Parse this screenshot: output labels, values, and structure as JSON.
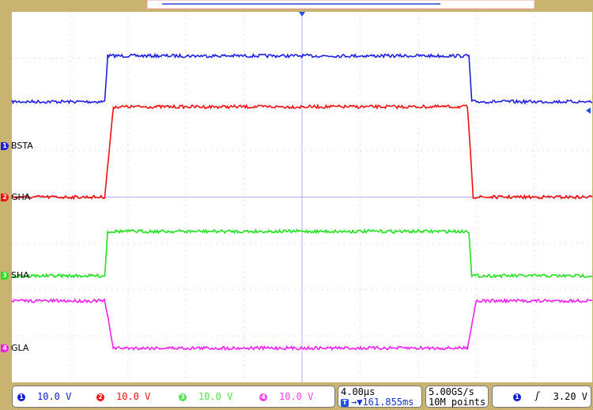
{
  "chart_data": {
    "type": "line",
    "x_unit": "µs",
    "x_per_div": 4,
    "x_range": [
      -20,
      20
    ],
    "y_per_div_V": 10,
    "grid": true,
    "series": [
      {
        "name": "BSTA",
        "channel": "1",
        "color": "#2020e0",
        "ground_div": -1.1,
        "points": [
          [
            -20,
            9.6
          ],
          [
            -13.6,
            9.6
          ],
          [
            -13.4,
            19.5
          ],
          [
            11.5,
            19.5
          ],
          [
            11.7,
            9.6
          ],
          [
            20,
            9.6
          ]
        ]
      },
      {
        "name": "GHA",
        "channel": "2",
        "color": "#f01010",
        "ground_div": 0,
        "points": [
          [
            -20,
            0
          ],
          [
            -13.6,
            0
          ],
          [
            -13.0,
            19.5
          ],
          [
            11.4,
            19.5
          ],
          [
            11.8,
            0
          ],
          [
            20,
            0
          ]
        ]
      },
      {
        "name": "SHA",
        "channel": "3",
        "color": "#20e020",
        "ground_div": 1.7,
        "points": [
          [
            -20,
            0
          ],
          [
            -13.6,
            0
          ],
          [
            -13.4,
            9.6
          ],
          [
            11.5,
            9.6
          ],
          [
            11.7,
            0
          ],
          [
            20,
            0
          ]
        ]
      },
      {
        "name": "GLA",
        "channel": "4",
        "color": "#f020f0",
        "ground_div": 3.26,
        "points": [
          [
            -20,
            10.2
          ],
          [
            -13.6,
            10.2
          ],
          [
            -13.0,
            0
          ],
          [
            11.4,
            0
          ],
          [
            12.0,
            10.2
          ],
          [
            20,
            10.2
          ]
        ]
      }
    ]
  },
  "status": {
    "channels": [
      {
        "num": "1",
        "scale": "10.0 V",
        "color": "#1020d0"
      },
      {
        "num": "2",
        "scale": "10.0 V",
        "color": "#f01010"
      },
      {
        "num": "3",
        "scale": "10.0 V",
        "color": "#50e050"
      },
      {
        "num": "4",
        "scale": "10.0 V",
        "color": "#f040f0"
      }
    ],
    "timebase": "4.00µs",
    "trigger_position": "▼161.855ms",
    "trigger_icon": "T",
    "sample_rate": "5.00GS/s",
    "record_length": "10M points",
    "trigger_source": "1",
    "trigger_slope": "rising-edge-icon",
    "trigger_level": "3.20 V"
  }
}
